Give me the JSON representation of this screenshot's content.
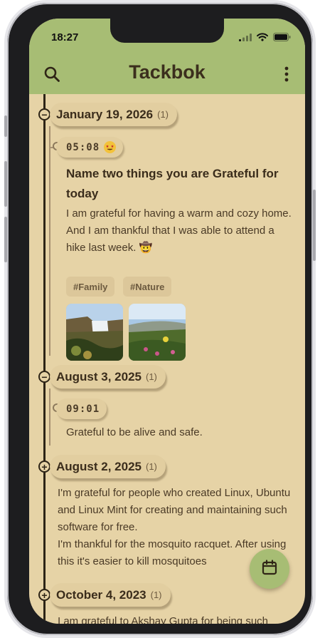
{
  "status": {
    "time": "18:27"
  },
  "appbar": {
    "title": "Tackbok"
  },
  "timeline": {
    "groups": [
      {
        "date": "January 19, 2026",
        "count": "(1)",
        "node": "−",
        "entries": [
          {
            "time": "05:08",
            "title": "Name two things you are Grateful for today",
            "body": "I am grateful for having a warm and cozy home. And I am thankful that I was able to attend a hike last week. 🤠",
            "tags": [
              "#Family",
              "#Nature"
            ]
          }
        ]
      },
      {
        "date": "August 3, 2025",
        "count": "(1)",
        "node": "−",
        "entries": [
          {
            "time": "09:01",
            "body": "Grateful to be alive and safe."
          }
        ]
      },
      {
        "date": "August 2, 2025",
        "count": "(1)",
        "node": "+",
        "preview": "I'm grateful for people who created Linux, Ubuntu and Linux Mint for creating and maintaining such software for free.\nI'm thankful for the mosquito racquet. After using this it's easier to kill mosquitoes"
      },
      {
        "date": "October 4, 2023",
        "count": "(1)",
        "node": "+",
        "preview": "I am grateful to Akshay Gupta for being such"
      }
    ]
  },
  "icons": {
    "search": "search-icon",
    "menu": "more-vertical-icon",
    "calendar": "calendar-icon"
  },
  "colors": {
    "appbar": "#a7bd74",
    "background": "#e6d3a6",
    "rail": "#2d2416",
    "text": "#3a2c1b"
  }
}
